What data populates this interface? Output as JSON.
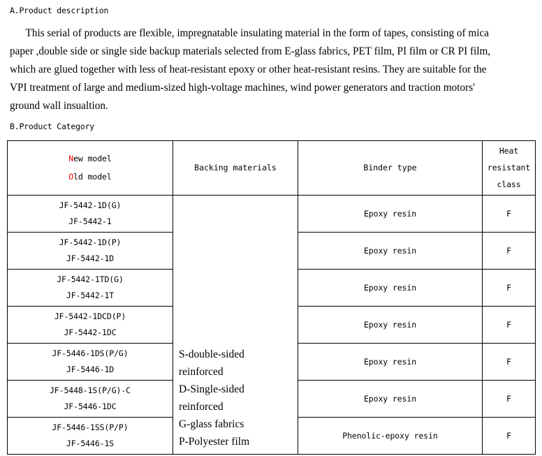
{
  "document": {
    "section_a_heading": "A.Product description",
    "section_b_heading": "B.Product Category",
    "description_paragraph": "This serial of products are flexible, impregnatable insulating material in the form of tapes, consisting of mica paper ,double side or single side backup materials selected from E-glass fabrics, PET film, PI film or CR PI film, which are glued together with less of heat-resistant epoxy or other heat-resistant resins. They are suitable for the VPI treatment of large and medium-sized high-voltage machines, wind power generators and traction motors' ground wall insualtion."
  },
  "colors": {
    "accent_red": "#ff0000",
    "text_black": "#000000",
    "border_black": "#000000",
    "page_background": "#ffffff"
  },
  "table": {
    "headers": {
      "model_new_initial": "N",
      "model_new_rest": "ew model",
      "model_old_initial": "O",
      "model_old_rest": "ld model",
      "backing_materials": "Backing materials",
      "binder_type": "Binder type",
      "heat_class_line1": "Heat",
      "heat_class_line2": "resistant",
      "heat_class_line3": "class"
    },
    "backing_materials_lines": [
      "S-double-sided",
      "reinforced",
      "D-Single-sided",
      "reinforced",
      "G-glass fabrics",
      "P-Polyester film"
    ],
    "rows": [
      {
        "new_model": "JF-5442-1D(G)",
        "old_model": "JF-5442-1",
        "binder_type": "Epoxy resin",
        "heat_class": "F"
      },
      {
        "new_model": "JF-5442-1D(P)",
        "old_model": "JF-5442-1D",
        "binder_type": "Epoxy resin",
        "heat_class": "F"
      },
      {
        "new_model": "JF-5442-1TD(G)",
        "old_model": "JF-5442-1T",
        "binder_type": "Epoxy resin",
        "heat_class": "F"
      },
      {
        "new_model": "JF-5442-1DCD(P)",
        "old_model": "JF-5442-1DC",
        "binder_type": "Epoxy resin",
        "heat_class": "F"
      },
      {
        "new_model": "JF-5446-1DS(P/G)",
        "old_model": "JF-5446-1D",
        "binder_type": "Epoxy resin",
        "heat_class": "F"
      },
      {
        "new_model": "JF-5448-1S(P/G)-C",
        "old_model": "JF-5446-1DC",
        "binder_type": "Epoxy resin",
        "heat_class": "F"
      },
      {
        "new_model": "JF-5446-1SS(P/P)",
        "old_model": "JF-5446-1S",
        "binder_type": "Phenolic-epoxy resin",
        "heat_class": "F"
      }
    ]
  }
}
